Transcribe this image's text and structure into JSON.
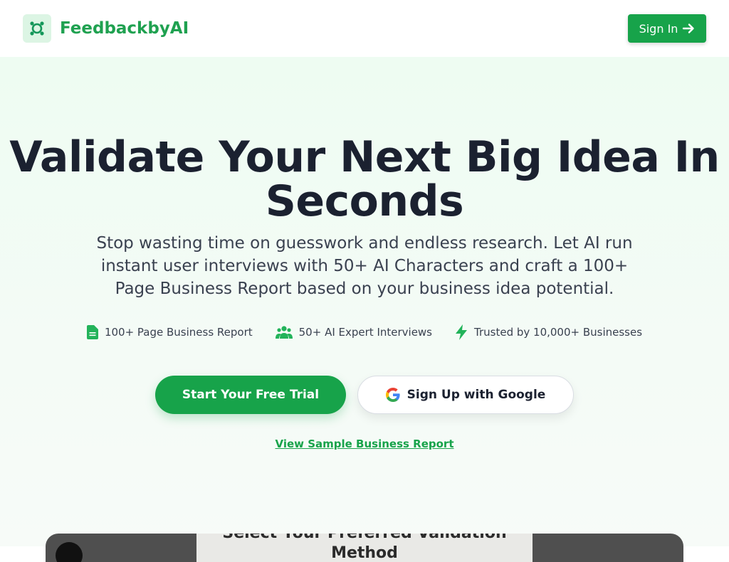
{
  "header": {
    "brand": "FeedbackbyAI",
    "signin_label": "Sign In"
  },
  "hero": {
    "title": "Validate Your Next Big Idea In Seconds",
    "subtitle": "Stop wasting time on guesswork and endless research. Let AI run instant user interviews with 50+ AI Characters and craft a 100+ Page Business Report based on your business idea potential.",
    "features": [
      {
        "icon": "document-icon",
        "label": "100+ Page Business Report"
      },
      {
        "icon": "users-icon",
        "label": "50+ AI Expert Interviews"
      },
      {
        "icon": "lightning-icon",
        "label": "Trusted by 10,000+ Businesses"
      }
    ],
    "cta_primary": "Start Your Free Trial",
    "cta_google": "Sign Up with Google",
    "sample_link": "View Sample Business Report"
  },
  "preview": {
    "text": "Select Your Preferred Validation Method"
  },
  "colors": {
    "brand_green": "#17a34a",
    "title_dark": "#1b2130",
    "hero_bg": "#eefcf2"
  }
}
